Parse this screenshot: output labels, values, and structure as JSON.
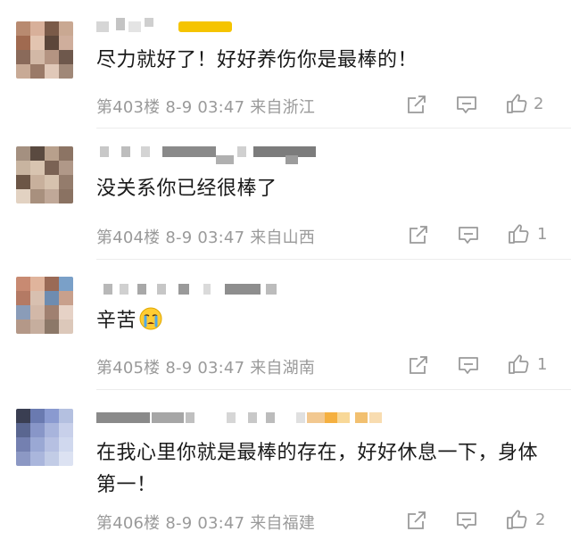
{
  "comments": [
    {
      "text": "尽力就好了！好好养伤你是最棒的！",
      "floor": "第403楼",
      "date": "8-9",
      "time": "03:47",
      "location": "来自浙江",
      "likes": "2",
      "colors": [
        "#b88a70",
        "#d8b09a",
        "#7a5a48",
        "#c9a892",
        "#a06a50",
        "#e2c4b0",
        "#5c463a",
        "#cfae9c",
        "#8a6a5a",
        "#d2b8a6",
        "#b49482",
        "#6e584c",
        "#c8aa96",
        "#9a7a68",
        "#e0c8b8",
        "#a08878"
      ]
    },
    {
      "text": "没关系你已经很棒了",
      "floor": "第404楼",
      "date": "8-9",
      "time": "03:47",
      "location": "来自山西",
      "likes": "1",
      "colors": [
        "#a49080",
        "#5a4a40",
        "#b8a08c",
        "#8c7464",
        "#c8b4a0",
        "#d8c4b0",
        "#7a6254",
        "#b09888",
        "#6c5646",
        "#c8b09c",
        "#d6c2ae",
        "#947c6c",
        "#e2d2c2",
        "#a8907e",
        "#c0a898",
        "#8a7262"
      ]
    },
    {
      "text": "辛苦",
      "emoji": "crying-face-icon",
      "floor": "第405楼",
      "date": "8-9",
      "time": "03:47",
      "location": "来自湖南",
      "likes": "1",
      "colors": [
        "#c88a72",
        "#e0b49c",
        "#9a6a56",
        "#7aa0c8",
        "#b47a64",
        "#d8c0b0",
        "#6e8cb0",
        "#c8a08c",
        "#8a9cb8",
        "#d2b8a8",
        "#a08070",
        "#e6d2c6",
        "#b49888",
        "#c6ae9e",
        "#8c7868",
        "#dcc8ba"
      ]
    },
    {
      "text": "在我心里你就是最棒的存在，好好休息一下，身体第一！",
      "floor": "第406楼",
      "date": "8-9",
      "time": "03:47",
      "location": "来自福建",
      "likes": "2",
      "colors": [
        "#3a3e52",
        "#6a7ab0",
        "#8a9ad0",
        "#b4c0e0",
        "#5a6690",
        "#8896c8",
        "#a8b4dc",
        "#c8d0ea",
        "#7480b0",
        "#9aa8d4",
        "#b6c0e2",
        "#d0d8ee",
        "#8c98c4",
        "#aab6dc",
        "#c2cce6",
        "#dce2f2"
      ]
    }
  ],
  "colors": {
    "text": "#1a1a1a",
    "meta": "#9a9a9a",
    "divider": "#ececec",
    "name_highlight": "#f5c400"
  }
}
